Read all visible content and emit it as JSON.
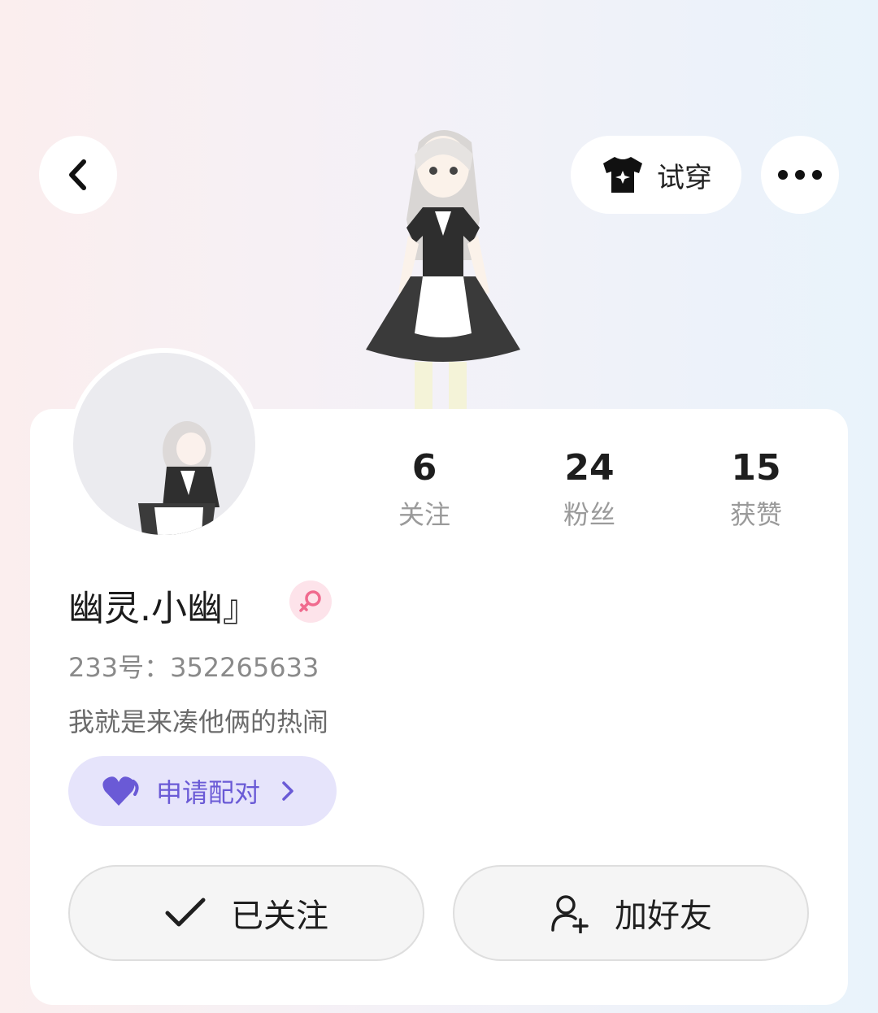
{
  "header": {
    "try_on_label": "试穿"
  },
  "stats": [
    {
      "value": "6",
      "label": "关注"
    },
    {
      "value": "24",
      "label": "粉丝"
    },
    {
      "value": "15",
      "label": "获赞"
    }
  ],
  "profile": {
    "name": "幽灵.小幽』",
    "gender_icon": "female-icon",
    "id_text": "233号：352265633",
    "bio": "我就是来凑他俩的热闹"
  },
  "pair_button": {
    "label": "申请配对",
    "icon": "heart-icon",
    "accent": "#6a5ad6"
  },
  "actions": {
    "followed_label": "已关注",
    "add_friend_label": "加好友"
  }
}
